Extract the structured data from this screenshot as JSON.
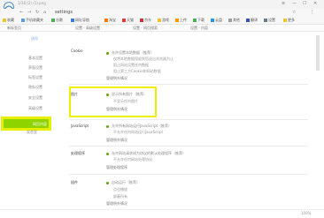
{
  "window": {
    "title": "1/16 (2) (1).png",
    "controls": [
      "≡",
      "—",
      "☐",
      "✕"
    ]
  },
  "nav": {
    "back": "←",
    "forward": "→",
    "reload": "↻",
    "home": "⌂"
  },
  "address": {
    "value": "settings",
    "right_icons": [
      "☆",
      "⋮"
    ]
  },
  "bookmarks": [
    {
      "label": "收藏"
    },
    {
      "label": "手机收藏夹"
    },
    {
      "label": "谷歌"
    },
    {
      "label": "网址导航"
    },
    {
      "label": "淘宝"
    },
    {
      "label": "天猫"
    },
    {
      "label": "京东"
    },
    {
      "label": "游戏"
    },
    {
      "label": "上传"
    },
    {
      "label": "下载"
    },
    {
      "label": "云盘"
    },
    {
      "label": "其他"
    },
    {
      "label": "翻译"
    },
    {
      "label": "设置"
    },
    {
      "label": "更多"
    }
  ],
  "tabs": [
    {
      "label": "新标签页"
    },
    {
      "label": "设置 - 高级设置"
    },
    {
      "label": "设置 - 网页搜索"
    },
    {
      "label": "设置 - 内容"
    }
  ],
  "sidebar": {
    "title": "选项",
    "items": [
      {
        "label": "基本设置"
      },
      {
        "label": "界面设置"
      },
      {
        "label": "标签设置"
      },
      {
        "label": "隐私设置"
      },
      {
        "label": "安全设置"
      },
      {
        "label": "高级设置"
      }
    ],
    "active": "网页内容",
    "after": "实验室"
  },
  "sections": [
    {
      "title": "Cookie",
      "options": [
        "允许设置本地数据（推荐）",
        "仅将本地数据保留到您退出浏览器为止",
        "阻止网站设置任何数据",
        "阻止第三方Cookie和网站数据"
      ],
      "button": "管理例外情况"
    },
    {
      "title": "图片",
      "options": [
        "显示所有图片（推荐）",
        "不显示任何图片"
      ],
      "button": "管理例外情况"
    },
    {
      "title": "JavaScript",
      "options": [
        "允许所有网站运行JavaScript（推荐）",
        "不允许任何网站运行JavaScript"
      ],
      "button": "管理例外情况"
    },
    {
      "title": "处理程序",
      "options": [
        "允许网站请求成为协议的默认处理程序（推荐）",
        "不允许任何网站处理协议"
      ],
      "button": "管理处理程序"
    },
    {
      "title": "插件",
      "options": [
        "自动运行（推荐）",
        "点击播放",
        "屏蔽所有"
      ],
      "button": "管理例外情况"
    }
  ],
  "status": {
    "left": "",
    "right": "100%"
  },
  "colors": {
    "highlight": "#ecf000",
    "active": "#8fd400",
    "accent": "#5ca600"
  }
}
